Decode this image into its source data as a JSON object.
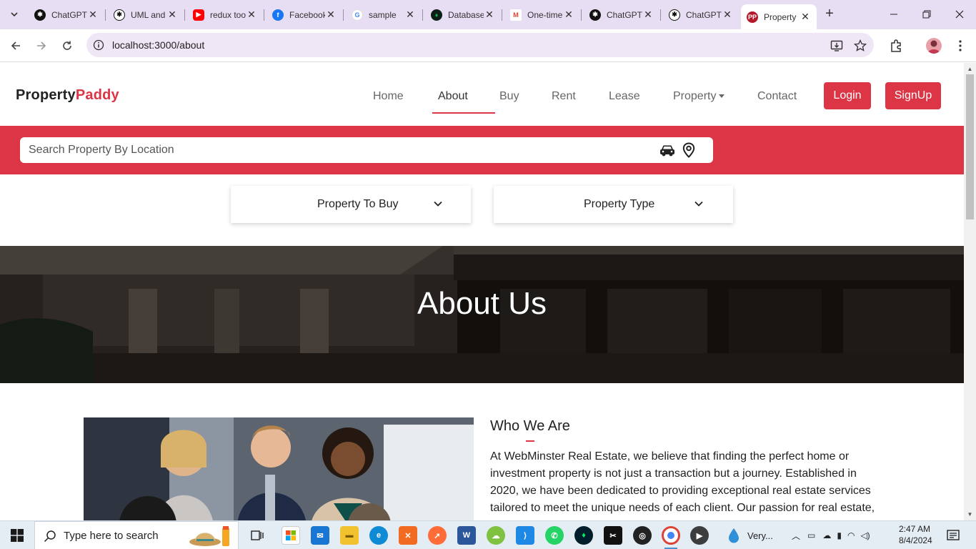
{
  "browser": {
    "tabs": [
      {
        "label": "ChatGPT",
        "favicon": "chatgpt-icon",
        "color": "#111111"
      },
      {
        "label": "UML and",
        "favicon": "chatgpt-icon",
        "color": "#111111"
      },
      {
        "label": "redux toolkit",
        "favicon": "youtube-icon",
        "color": "#ff0000"
      },
      {
        "label": "Facebook",
        "favicon": "facebook-icon",
        "color": "#1877f2"
      },
      {
        "label": "sample",
        "favicon": "google-icon",
        "color": "#4285f4"
      },
      {
        "label": "Database",
        "favicon": "mongodb-icon",
        "color": "#13aa52"
      },
      {
        "label": "One-time",
        "favicon": "gmail-icon",
        "color": "#ea4335"
      },
      {
        "label": "ChatGPT",
        "favicon": "chatgpt-icon",
        "color": "#111111"
      },
      {
        "label": "ChatGPT",
        "favicon": "chatgpt-icon",
        "color": "#111111"
      },
      {
        "label": "Property",
        "favicon": "propertypaddy-icon",
        "color": "#b5172b",
        "active": true
      }
    ],
    "url": "localhost:3000/about"
  },
  "navbar": {
    "brand_part1": "Property",
    "brand_part2": "Paddy",
    "links": [
      "Home",
      "About",
      "Buy",
      "Rent",
      "Lease",
      "Property",
      "Contact"
    ],
    "active_link": "About",
    "login": "Login",
    "signup": "SignUp"
  },
  "search": {
    "placeholder": "Search Property By Location"
  },
  "filters": {
    "buy_select": "Property To Buy",
    "type_select": "Property Type"
  },
  "hero": {
    "title": "About Us"
  },
  "about": {
    "heading": "Who We Are",
    "paragraph": "At WebMinster Real Estate, we believe that finding the perfect home or investment property is not just a transaction but a journey. Established in 2020, we have been dedicated to providing exceptional real estate services tailored to meet the unique needs of each client. Our passion for real estate,"
  },
  "taskbar": {
    "search_placeholder": "Type here to search",
    "weather": "Very...",
    "time": "2:47 AM",
    "date": "8/4/2024"
  },
  "colors": {
    "accent": "#dc3545",
    "tabstrip": "#e8def3"
  }
}
